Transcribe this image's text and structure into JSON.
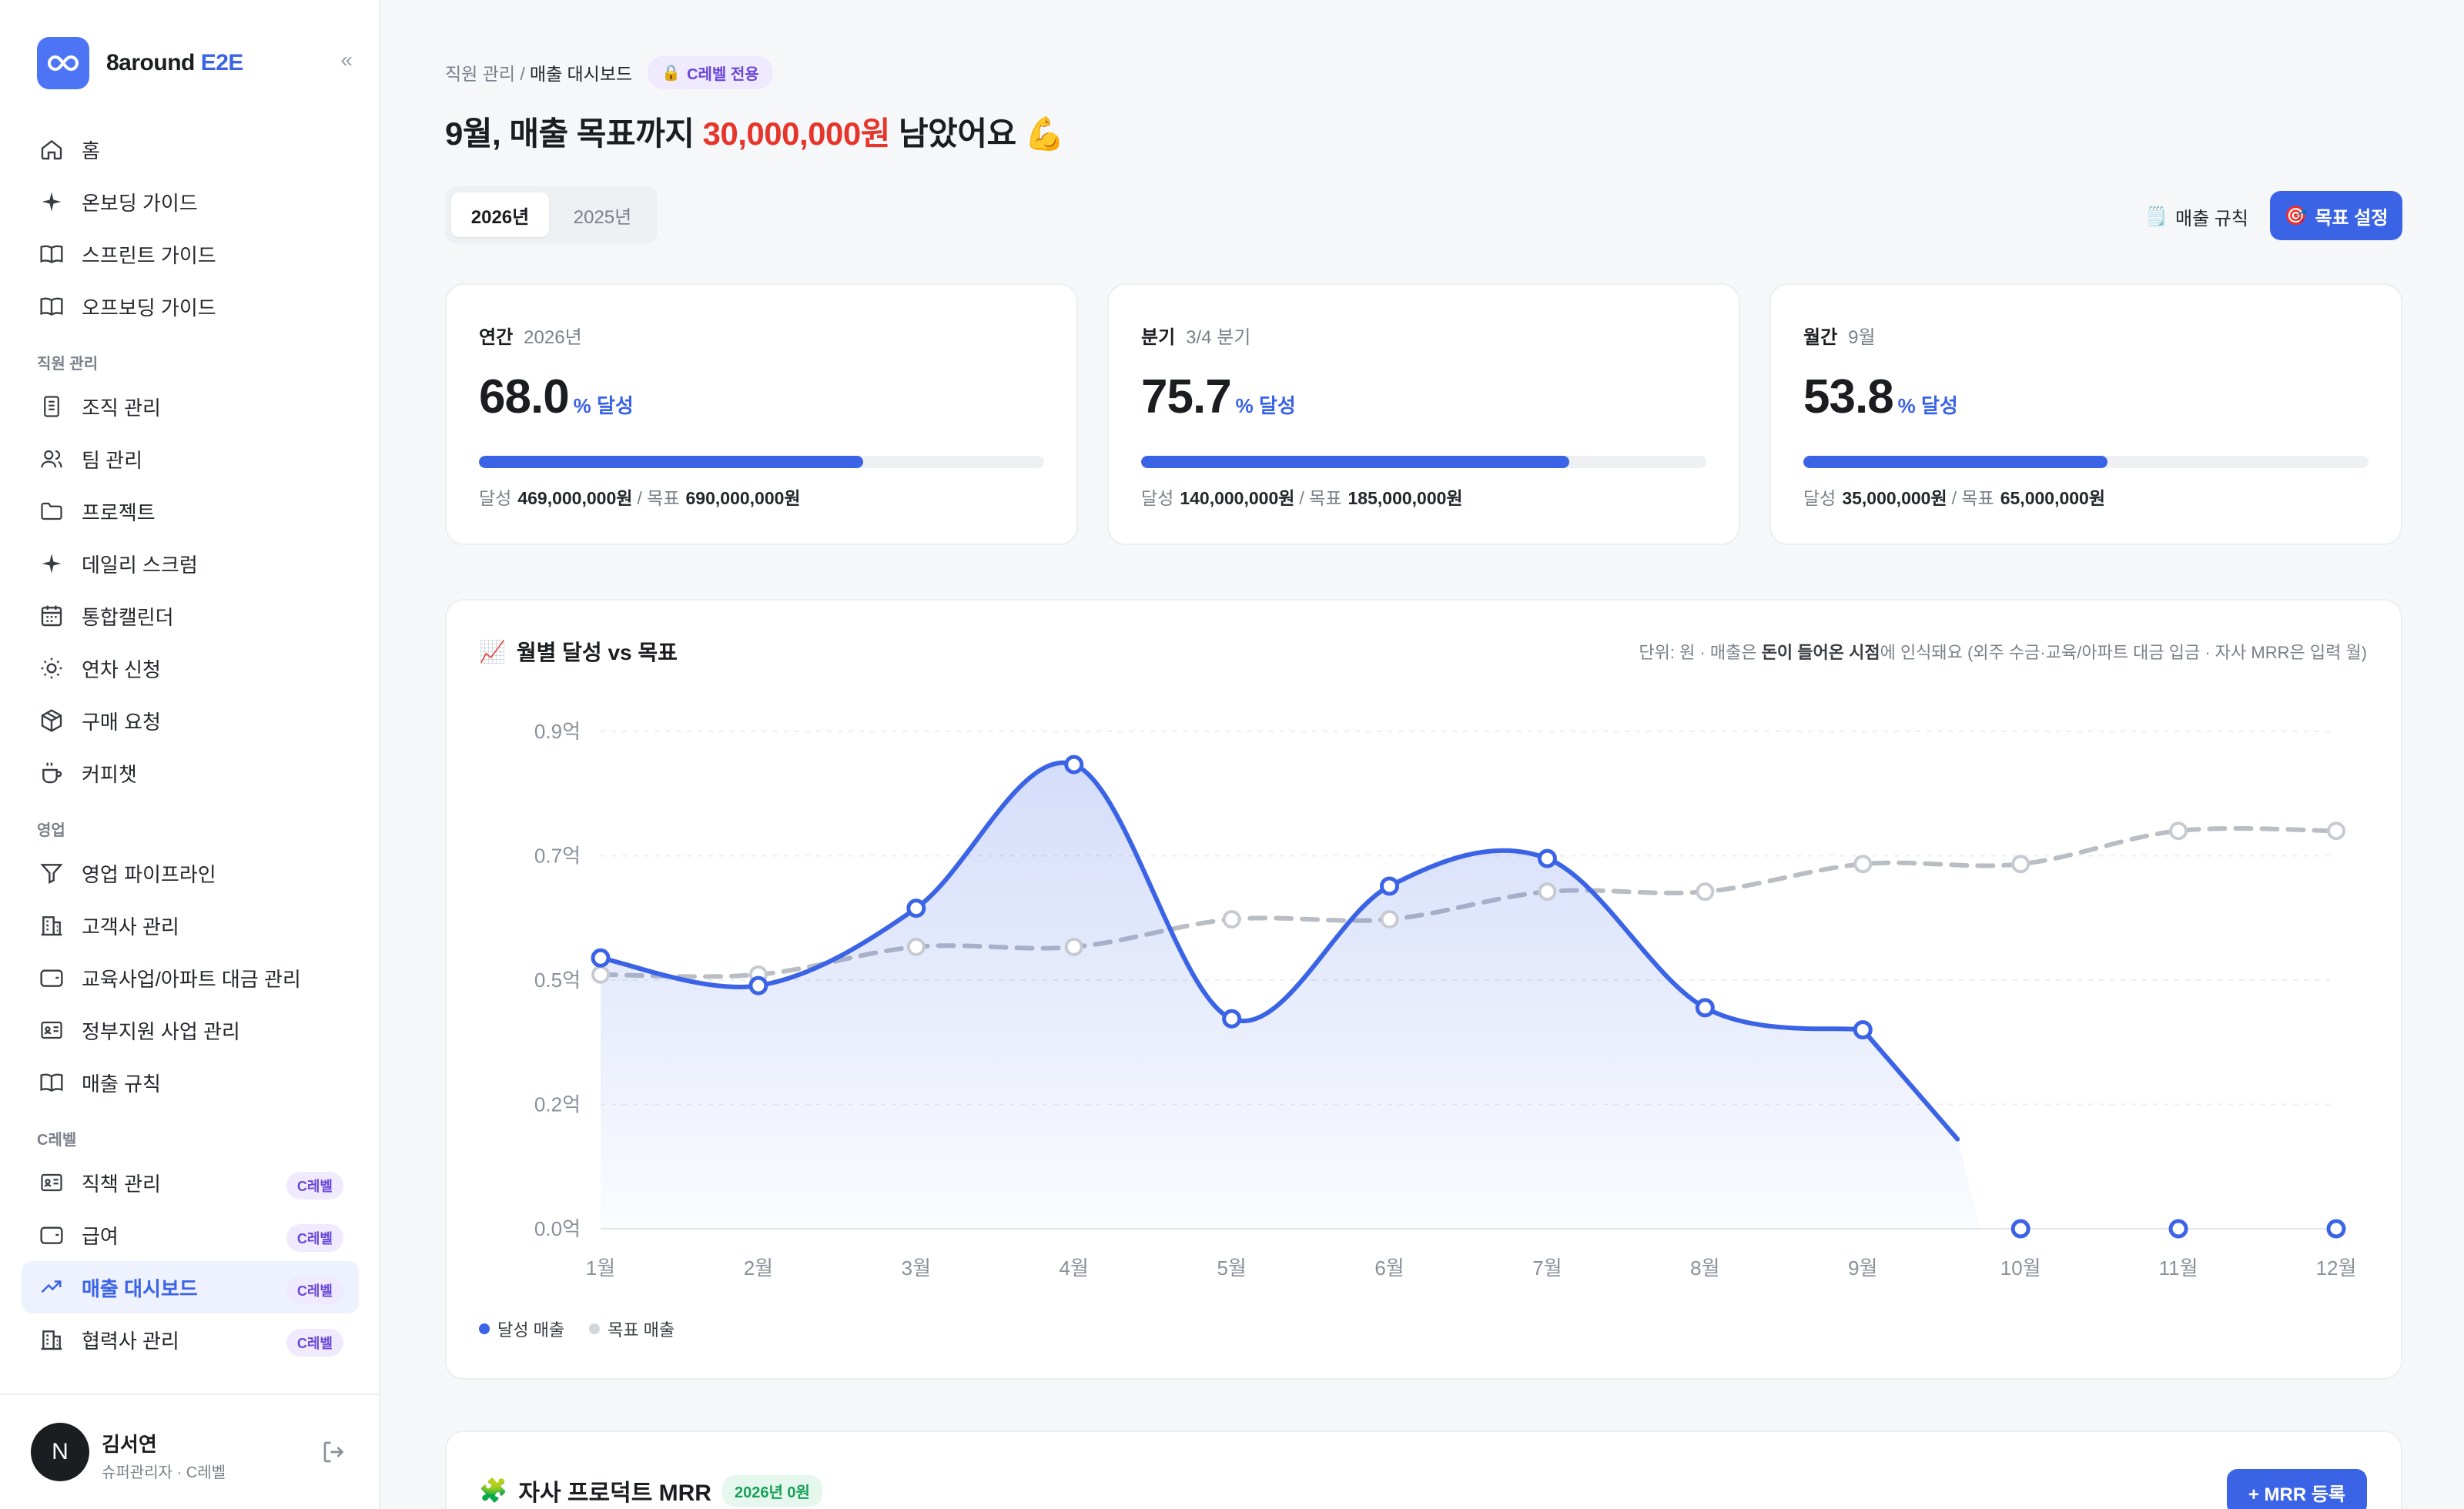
{
  "brand": {
    "name": "8around",
    "accent": "E2E"
  },
  "sidebar": {
    "items": [
      {
        "label": "홈"
      },
      {
        "label": "온보딩 가이드"
      },
      {
        "label": "스프린트 가이드"
      },
      {
        "label": "오프보딩 가이드"
      }
    ],
    "sections": [
      {
        "title": "직원 관리",
        "items": [
          {
            "label": "조직 관리"
          },
          {
            "label": "팀 관리"
          },
          {
            "label": "프로젝트"
          },
          {
            "label": "데일리 스크럼"
          },
          {
            "label": "통합캘린더"
          },
          {
            "label": "연차 신청"
          },
          {
            "label": "구매 요청"
          },
          {
            "label": "커피챗"
          }
        ]
      },
      {
        "title": "영업",
        "items": [
          {
            "label": "영업 파이프라인"
          },
          {
            "label": "고객사 관리"
          },
          {
            "label": "교육사업/아파트 대금 관리"
          },
          {
            "label": "정부지원 사업 관리"
          },
          {
            "label": "매출 규칙"
          }
        ]
      },
      {
        "title": "C레벨",
        "items": [
          {
            "label": "직책 관리",
            "badge": "C레벨"
          },
          {
            "label": "급여",
            "badge": "C레벨"
          },
          {
            "label": "매출 대시보드",
            "badge": "C레벨"
          },
          {
            "label": "협력사 관리",
            "badge": "C레벨"
          }
        ]
      }
    ],
    "user": {
      "initial": "N",
      "name": "김서연",
      "role": "슈퍼관리자 · C레벨"
    }
  },
  "header": {
    "breadcrumb_parent": "직원 관리 /",
    "breadcrumb_current": "매출 대시보드",
    "badge": "C레벨 전용",
    "title_prefix": "9월, 매출 목표까지 ",
    "title_amount": "30,000,000원",
    "title_suffix": " 남았어요 💪"
  },
  "year_tabs": [
    "2026년",
    "2025년"
  ],
  "actions": {
    "rules": "매출 규칙",
    "goal": "목표 설정"
  },
  "kpis": [
    {
      "label": "연간",
      "period": "2026년",
      "percent": "68.0",
      "unit": "% 달성",
      "progress": 0.68,
      "achieved_label": "달성",
      "achieved": "469,000,000원",
      "target_label": "/ 목표",
      "target": "690,000,000원"
    },
    {
      "label": "분기",
      "period": "3/4 분기",
      "percent": "75.7",
      "unit": "% 달성",
      "progress": 0.757,
      "achieved_label": "달성",
      "achieved": "140,000,000원",
      "target_label": "/ 목표",
      "target": "185,000,000원"
    },
    {
      "label": "월간",
      "period": "9월",
      "percent": "53.8",
      "unit": "% 달성",
      "progress": 0.538,
      "achieved_label": "달성",
      "achieved": "35,000,000원",
      "target_label": "/ 목표",
      "target": "65,000,000원"
    }
  ],
  "chart_section": {
    "title": "월별 달성 vs 목표",
    "note_prefix": "단위: 원 · 매출은 ",
    "note_bold": "돈이 들어온 시점",
    "note_suffix": "에 인식돼요 (외주 수금·교육/아파트 대금 입금 · 자사 MRR은 입력 월)"
  },
  "chart_data": {
    "type": "line",
    "categories": [
      "1월",
      "2월",
      "3월",
      "4월",
      "5월",
      "6월",
      "7월",
      "8월",
      "9월",
      "10월",
      "11월",
      "12월"
    ],
    "y_ticks": [
      "0.0억",
      "0.2억",
      "0.5억",
      "0.7억",
      "0.9억"
    ],
    "ylim": [
      0,
      0.9
    ],
    "series": [
      {
        "name": "달성 매출",
        "color": "#3b63e6",
        "values": [
          0.49,
          0.44,
          0.58,
          0.84,
          0.38,
          0.62,
          0.67,
          0.4,
          0.36,
          0,
          0,
          0
        ]
      },
      {
        "name": "목표 매출",
        "color": "#b9bdc4",
        "values": [
          0.46,
          0.46,
          0.51,
          0.51,
          0.56,
          0.56,
          0.61,
          0.61,
          0.66,
          0.66,
          0.72,
          0.72
        ]
      }
    ]
  },
  "mrr": {
    "title": "자사 프로덕트 MRR",
    "badge": "2026년 0원",
    "button": "+ MRR 등록"
  },
  "colors": {
    "accent": "#3b63e6",
    "danger": "#e6352b",
    "purple": "#6a47d8"
  }
}
